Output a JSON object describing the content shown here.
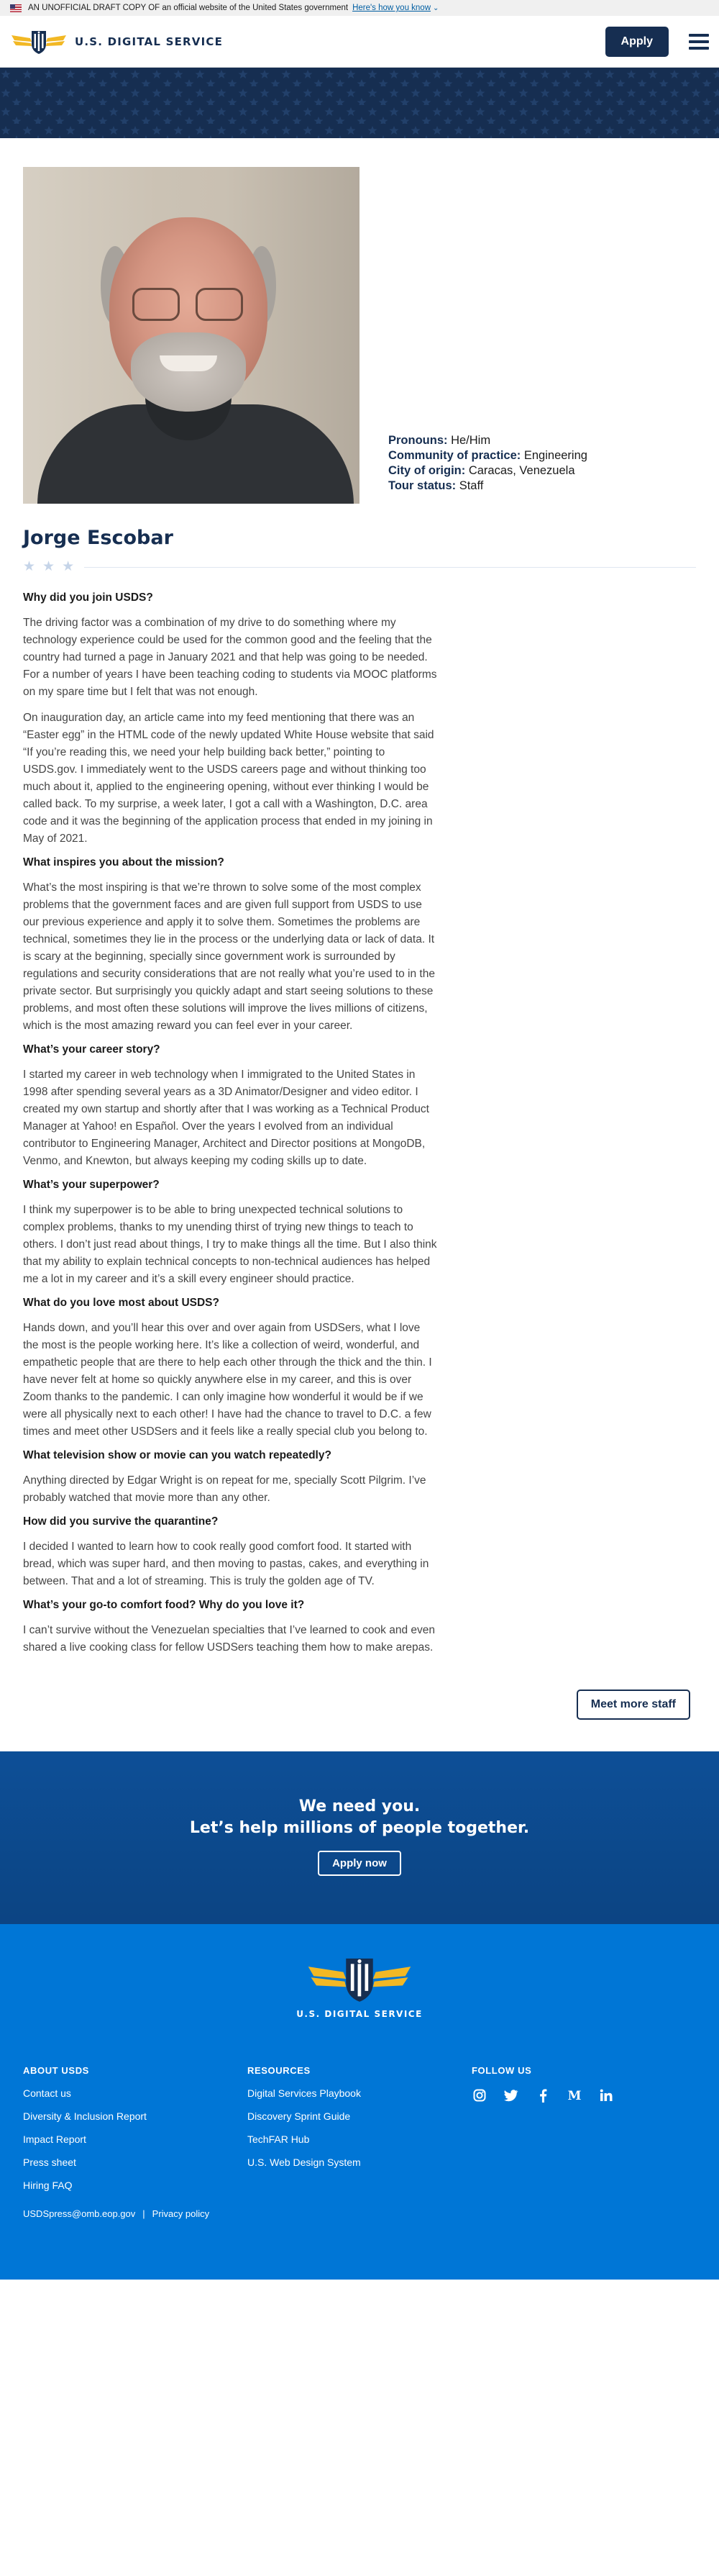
{
  "gov_banner": {
    "text": "AN UNOFFICIAL DRAFT COPY OF an official website of the United States government",
    "link": "Here's how you know"
  },
  "header": {
    "logo_text": "U.S. DIGITAL SERVICE",
    "apply_label": "Apply"
  },
  "profile": {
    "name": "Jorge Escobar",
    "meta": [
      {
        "label": "Pronouns:",
        "value": "He/Him"
      },
      {
        "label": "Community of practice:",
        "value": "Engineering"
      },
      {
        "label": "City of origin:",
        "value": "Caracas, Venezuela"
      },
      {
        "label": "Tour status:",
        "value": "Staff"
      }
    ]
  },
  "qa": [
    {
      "q": "Why did you join USDS?",
      "a": [
        "The driving factor was a combination of my drive to do something where my technology experience could be used for the common good and the feeling that the country had turned a page in January 2021 and that help was going to be needed. For a number of years I have been teaching coding to students via MOOC platforms on my spare time but I felt that was not enough.",
        "On inauguration day, an article came into my feed mentioning that there was an “Easter egg” in the HTML code of the newly updated White House website that said “If you’re reading this, we need your help building back better,” pointing to USDS.gov. I immediately went to the USDS careers page and without thinking too much about it, applied to the engineering opening, without ever thinking I would be called back. To my surprise, a week later, I got a call with a Washington, D.C. area code and it was the beginning of the application process that ended in my joining in May of 2021."
      ]
    },
    {
      "q": "What inspires you about the mission?",
      "a": [
        "What’s the most inspiring is that we’re thrown to solve some of the most complex problems that the government faces and are given full support from USDS to use our previous experience and apply it to solve them. Sometimes the problems are technical, sometimes they lie in the process or the underlying data or lack of data. It is scary at the beginning, specially since government work is surrounded by regulations and security considerations that are not really what you’re used to in the private sector. But surprisingly you quickly adapt and start seeing solutions to these problems, and most often these solutions will improve the lives millions of citizens, which is the most amazing reward you can feel ever in your career."
      ]
    },
    {
      "q": "What’s your career story?",
      "a": [
        "I started my career in web technology when I immigrated to the United States in 1998 after spending several years as a 3D Animator/Designer and video editor. I created my own startup and shortly after that I was working as a Technical Product Manager at Yahoo! en Español. Over the years I evolved from an individual contributor to Engineering Manager, Architect and Director positions at MongoDB, Venmo, and Knewton, but always keeping my coding skills up to date."
      ]
    },
    {
      "q": "What’s your superpower?",
      "a": [
        "I think my superpower is to be able to bring unexpected technical solutions to complex problems, thanks to my unending thirst of trying new things to teach to others. I don’t just read about things, I try to make things all the time. But I also think that my ability to explain technical concepts to non-technical audiences has helped me a lot in my career and it’s a skill every engineer should practice."
      ]
    },
    {
      "q": "What do you love most about USDS?",
      "a": [
        "Hands down, and you’ll hear this over and over again from USDSers, what I love the most is the people working here. It’s like a collection of weird, wonderful, and empathetic people that are there to help each other through the thick and the thin. I have never felt at home so quickly anywhere else in my career, and this is over Zoom thanks to the pandemic. I can only imagine how wonderful it would be if we were all physically next to each other! I have had the chance to travel to D.C. a few times and meet other USDSers and it feels like a really special club you belong to."
      ]
    },
    {
      "q": "What television show or movie can you watch repeatedly?",
      "a": [
        "Anything directed by Edgar Wright is on repeat for me, specially Scott Pilgrim. I’ve probably watched that movie more than any other."
      ]
    },
    {
      "q": "How did you survive the quarantine?",
      "a": [
        "I decided I wanted to learn how to cook really good comfort food. It started with bread, which was super hard, and then moving to pastas, cakes, and everything in between. That and a lot of streaming. This is truly the golden age of TV."
      ]
    },
    {
      "q": "What’s your go-to comfort food? Why do you love it?",
      "a": [
        "I can’t survive without the Venezuelan specialties that I’ve learned to cook and even shared a live cooking class for fellow USDSers teaching them how to make arepas."
      ]
    }
  ],
  "meet_more_label": "Meet more staff",
  "cta": {
    "line1": "We need you.",
    "line2": "Let’s help millions of people together.",
    "button": "Apply now"
  },
  "footer": {
    "logo_text": "U.S. DIGITAL SERVICE",
    "about": {
      "heading": "ABOUT USDS",
      "links": [
        "Contact us",
        "Diversity & Inclusion Report",
        "Impact Report",
        "Press sheet",
        "Hiring FAQ"
      ]
    },
    "resources": {
      "heading": "RESOURCES",
      "links": [
        "Digital Services Playbook",
        "Discovery Sprint Guide",
        "TechFAR Hub",
        "U.S. Web Design System"
      ]
    },
    "follow": {
      "heading": "FOLLOW US",
      "icons": [
        "instagram-icon",
        "twitter-icon",
        "facebook-icon",
        "medium-icon",
        "linkedin-icon"
      ]
    },
    "email": "USDSpress@omb.eop.gov",
    "privacy": "Privacy policy"
  }
}
